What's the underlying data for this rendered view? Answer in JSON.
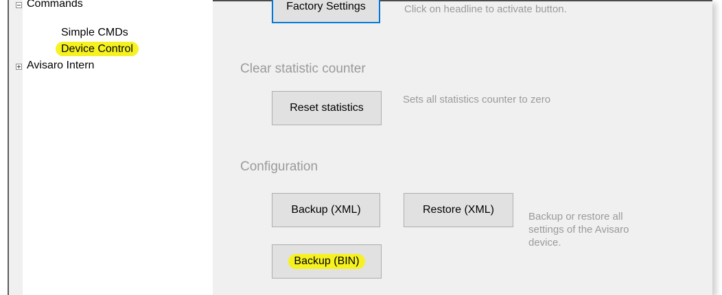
{
  "tree": {
    "items": [
      {
        "label": "Commands",
        "expander": "minus"
      },
      {
        "label": "Simple CMDs"
      },
      {
        "label": "Device Control",
        "highlighted": true
      },
      {
        "label": "Avisaro Intern",
        "expander": "plus"
      }
    ]
  },
  "top_partial": {
    "button_label": "Factory Settings",
    "description": "Click on headline to activate button."
  },
  "sections": {
    "clear_statistic": {
      "title": "Clear statistic counter",
      "button_label": "Reset statistics",
      "description": "Sets all statistics counter to zero"
    },
    "configuration": {
      "title": "Configuration",
      "backup_xml_label": "Backup (XML)",
      "restore_xml_label": "Restore (XML)",
      "backup_bin_label": "Backup (BIN)",
      "description": "Backup or restore all settings of the Avisaro device."
    }
  },
  "colors": {
    "highlight": "#f6f221",
    "focus_border": "#0078d7",
    "disabled_text": "#9a9a9a"
  }
}
